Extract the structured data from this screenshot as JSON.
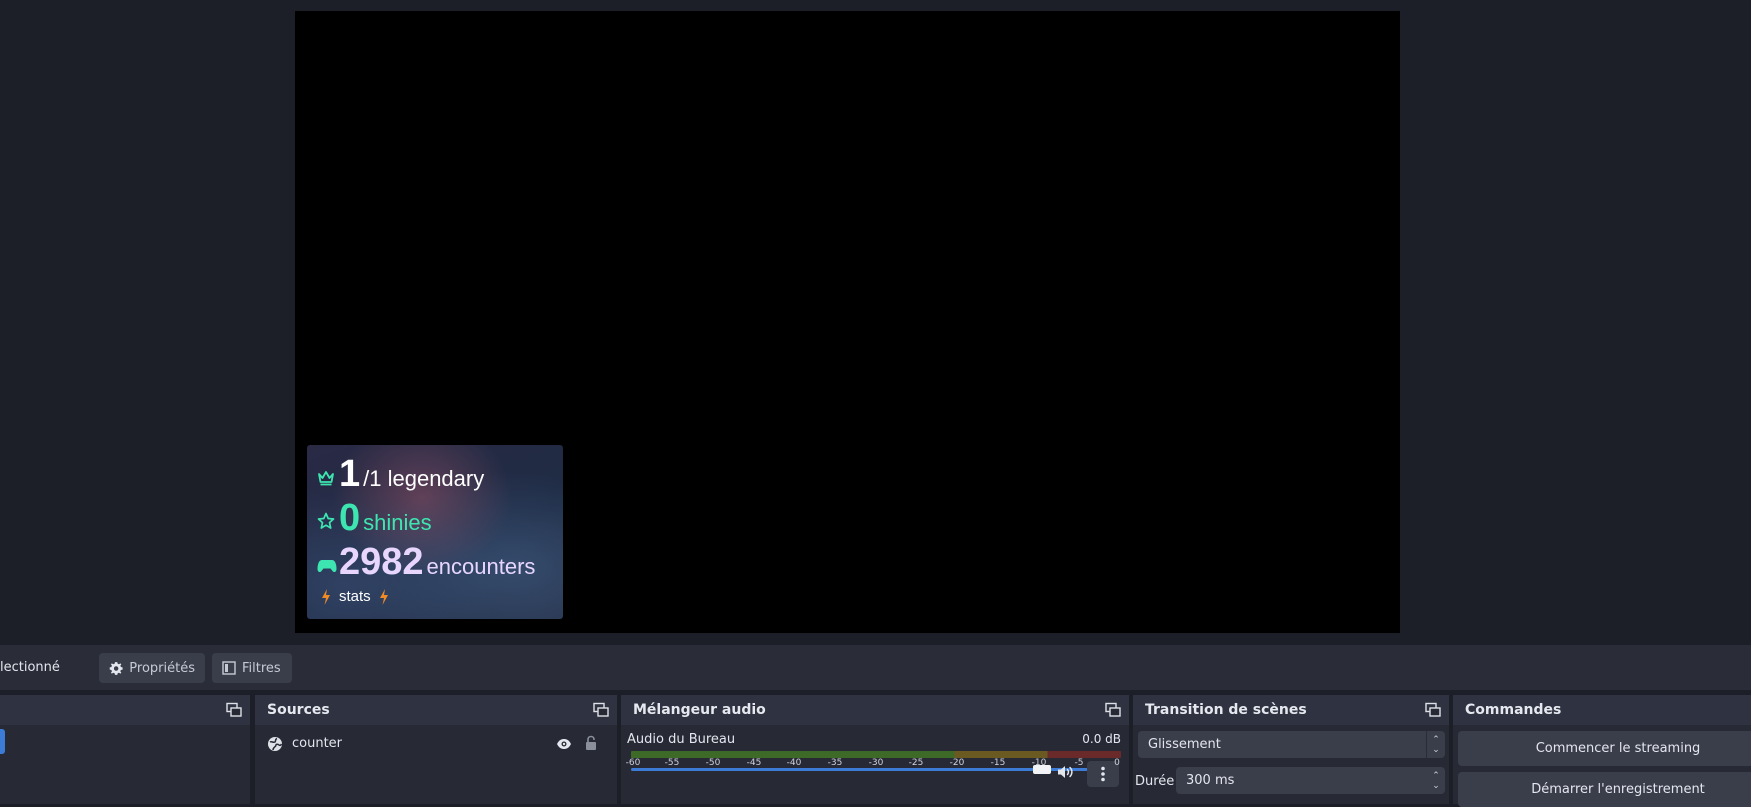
{
  "overlay": {
    "legendary_count": "1",
    "legendary_total": "/1 legendary",
    "shinies_count": "0",
    "shinies_label": "shinies",
    "encounters_count": "2982",
    "encounters_label": "encounters",
    "stats_label": "stats"
  },
  "toolbar": {
    "selected_text": "lectionné",
    "properties_label": "Propriétés",
    "filters_label": "Filtres"
  },
  "sources": {
    "title": "Sources",
    "items": [
      {
        "name": "counter"
      }
    ]
  },
  "mixer": {
    "title": "Mélangeur audio",
    "channel_name": "Audio du Bureau",
    "level": "0.0 dB",
    "scale": [
      "-60",
      "-55",
      "-50",
      "-45",
      "-40",
      "-35",
      "-30",
      "-25",
      "-20",
      "-15",
      "-10",
      "-5",
      "0"
    ],
    "volume_fraction": 0.97
  },
  "transitions": {
    "title": "Transition de scènes",
    "selected": "Glissement",
    "duration_label": "Durée",
    "duration_value": "300 ms"
  },
  "controls": {
    "title": "Commandes",
    "start_streaming": "Commencer le streaming",
    "start_recording": "Démarrer l'enregistrement"
  },
  "colors": {
    "accent": "#3c7bd6",
    "legendary": "#ffffff",
    "shiny": "#3de6b0",
    "encounters": "#e8d6ff",
    "stats_bolt": "#f08a24"
  }
}
